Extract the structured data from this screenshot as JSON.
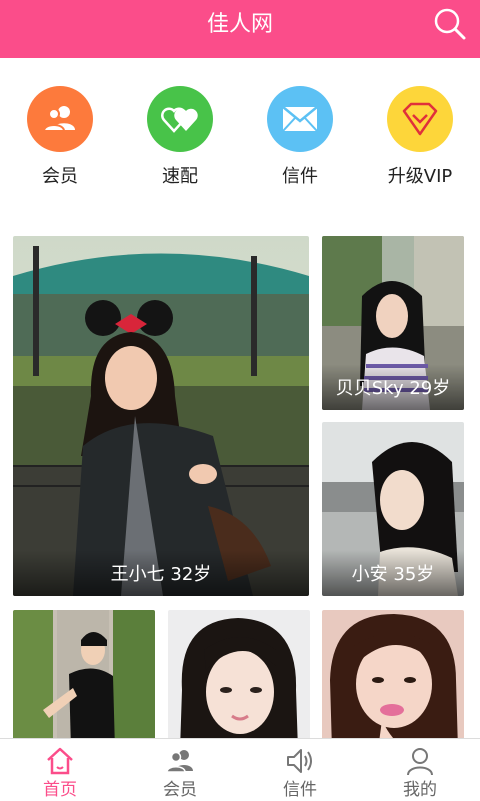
{
  "app": {
    "title": "佳人网"
  },
  "header": {
    "search_icon": "search-icon"
  },
  "quick_actions": [
    {
      "label": "会员",
      "icon": "members-icon",
      "color": "#fd7a3c"
    },
    {
      "label": "速配",
      "icon": "hearts-icon",
      "color": "#48c349"
    },
    {
      "label": "信件",
      "icon": "mail-icon",
      "color": "#5cc1f4"
    },
    {
      "label": "升级VIP",
      "icon": "diamond-icon",
      "color": "#fdd63a"
    }
  ],
  "profiles": [
    {
      "caption": "王小七 32岁"
    },
    {
      "caption": "贝贝Sky 29岁"
    },
    {
      "caption": "小安 35岁"
    },
    {
      "caption": ""
    },
    {
      "caption": ""
    },
    {
      "caption": ""
    }
  ],
  "tabs": [
    {
      "label": "首页",
      "icon": "home-icon",
      "active": true
    },
    {
      "label": "会员",
      "icon": "members-icon",
      "active": false
    },
    {
      "label": "信件",
      "icon": "speaker-icon",
      "active": false
    },
    {
      "label": "我的",
      "icon": "profile-icon",
      "active": false
    }
  ],
  "colors": {
    "brand": "#fb4d8a",
    "tab_active": "#fb4d8a",
    "tab_inactive": "#666666"
  }
}
